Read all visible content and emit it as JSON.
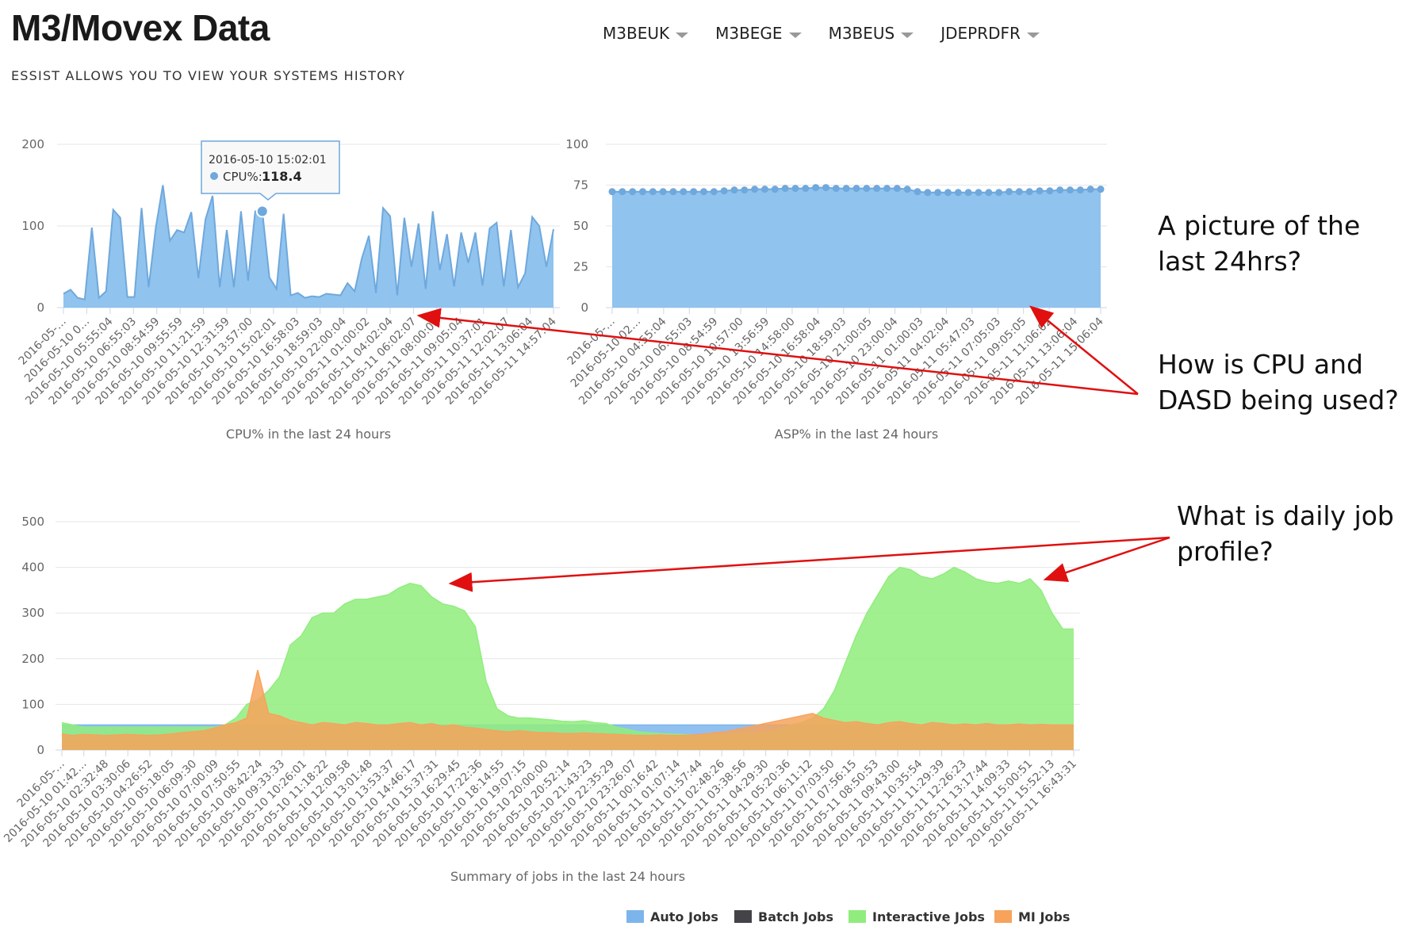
{
  "header": {
    "title": "M3/Movex Data",
    "subtitle": "ESSIST ALLOWS YOU TO VIEW YOUR SYSTEMS HISTORY",
    "nav": [
      "M3BEUK",
      "M3BEGE",
      "M3BEUS",
      "JDEPRDFR"
    ]
  },
  "callouts": {
    "c1": [
      "A picture of the",
      "last 24hrs?"
    ],
    "c2": [
      "How is CPU and",
      "DASD being used?"
    ],
    "c3": [
      "What is daily job",
      "profile?"
    ]
  },
  "colors": {
    "cpu_fill": "#90c3ee",
    "cpu_line": "#6fa8dc",
    "auto": "#7cb5ec",
    "batch": "#434348",
    "interactive": "#90ed7d",
    "mi": "#f7a35c",
    "arrow": "#e01010"
  },
  "chart_data": [
    {
      "type": "area",
      "title": "CPU% in the last 24 hours",
      "ylim": [
        0,
        200
      ],
      "yticks": [
        0,
        100,
        200
      ],
      "grid": true,
      "xtick_labels": [
        "2016-05-…",
        "2016-05-10 0…",
        "2016-05-10 05:55:04",
        "2016-05-10 06:55:03",
        "2016-05-10 08:54:59",
        "2016-05-10 09:55:59",
        "2016-05-10 11:21:59",
        "2016-05-10 12:31:59",
        "2016-05-10 13:57:00",
        "2016-05-10 15:02:01",
        "2016-05-10 16:58:03",
        "2016-05-10 18:59:03",
        "2016-05-10 22:00:04",
        "2016-05-11 01:00:02",
        "2016-05-11 04:02:04",
        "2016-05-11 06:02:07",
        "2016-05-11 08:00:03",
        "2016-05-11 09:05:04",
        "2016-05-11 10:37:01",
        "2016-05-11 12:02:07",
        "2016-05-11 13:06:04",
        "2016-05-11 14:57:04"
      ],
      "values": [
        17,
        22,
        12,
        10,
        98,
        12,
        20,
        120,
        110,
        13,
        13,
        122,
        25,
        98,
        150,
        82,
        95,
        92,
        117,
        36,
        108,
        137,
        25,
        95,
        25,
        118,
        33,
        118,
        118,
        37,
        23,
        115,
        15,
        18,
        12,
        14,
        13,
        17,
        16,
        15,
        30,
        20,
        60,
        88,
        18,
        122,
        112,
        15,
        110,
        50,
        103,
        23,
        118,
        46,
        90,
        26,
        92,
        55,
        92,
        27,
        97,
        104,
        26,
        95,
        25,
        42,
        111,
        100,
        50,
        96
      ],
      "tooltip": {
        "label": "2016-05-10 15:02:01",
        "series": "CPU%:",
        "value": "118.4",
        "index": 28
      }
    },
    {
      "type": "area",
      "title": "ASP% in the last 24 hours",
      "ylim": [
        0,
        100
      ],
      "yticks": [
        0,
        25,
        50,
        75,
        100
      ],
      "grid": true,
      "xtick_labels": [
        "2016-05-…",
        "2016-05-10 02…",
        "2016-05-10 04:55:04",
        "2016-05-10 06:55:03",
        "2016-05-10 08:54:59",
        "2016-05-10 10:57:00",
        "2016-05-10 13:56:59",
        "2016-05-10 14:58:00",
        "2016-05-10 16:58:04",
        "2016-05-10 18:59:03",
        "2016-05-10 21:00:05",
        "2016-05-10 23:00:04",
        "2016-05-11 01:00:03",
        "2016-05-11 04:02:04",
        "2016-05-11 05:47:03",
        "2016-05-11 07:05:03",
        "2016-05-11 09:05:05",
        "2016-05-11 11:06:02",
        "2016-05-11 13:06:04",
        "2016-05-11 15:06:04"
      ],
      "values": [
        71,
        71,
        71,
        71,
        71,
        71,
        71,
        71,
        71,
        71,
        71,
        71.5,
        72,
        72,
        72.5,
        72.5,
        72.5,
        73,
        73,
        73,
        73.5,
        73.5,
        73,
        73,
        73,
        73,
        73,
        73,
        73,
        72.5,
        71,
        70.5,
        70.5,
        70.5,
        70.5,
        70.5,
        70.5,
        70.5,
        70.5,
        71,
        71,
        71,
        71.5,
        71.5,
        72,
        72,
        72,
        72.5,
        72.5
      ]
    },
    {
      "type": "area",
      "title": "Summary of jobs in the last 24 hours",
      "ylim": [
        0,
        500
      ],
      "yticks": [
        0,
        100,
        200,
        300,
        400,
        500
      ],
      "grid": true,
      "legend": "bottom-right",
      "xtick_labels": [
        "2016-05-…",
        "2016-05-10 01:42…",
        "2016-05-10 02:32:48",
        "2016-05-10 03:30:06",
        "2016-05-10 04:26:52",
        "2016-05-10 05:18:05",
        "2016-05-10 06:09:30",
        "2016-05-10 07:00:09",
        "2016-05-10 07:50:55",
        "2016-05-10 08:42:24",
        "2016-05-10 09:33:33",
        "2016-05-10 10:26:01",
        "2016-05-10 11:18:22",
        "2016-05-10 12:09:58",
        "2016-05-10 13:01:48",
        "2016-05-10 13:53:37",
        "2016-05-10 14:46:17",
        "2016-05-10 15:37:31",
        "2016-05-10 16:29:45",
        "2016-05-10 17:22:36",
        "2016-05-10 18:14:55",
        "2016-05-10 19:07:15",
        "2016-05-10 20:00:00",
        "2016-05-10 20:52:14",
        "2016-05-10 21:43:23",
        "2016-05-10 22:35:29",
        "2016-05-10 23:26:07",
        "2016-05-11 00:16:42",
        "2016-05-11 01:07:14",
        "2016-05-11 01:57:44",
        "2016-05-11 02:48:26",
        "2016-05-11 03:38:56",
        "2016-05-11 04:29:30",
        "2016-05-11 05:20:36",
        "2016-05-11 06:11:12",
        "2016-05-11 07:03:50",
        "2016-05-11 07:56:15",
        "2016-05-11 08:50:53",
        "2016-05-11 09:43:00",
        "2016-05-11 10:35:54",
        "2016-05-11 11:29:39",
        "2016-05-11 12:26:23",
        "2016-05-11 13:17:44",
        "2016-05-11 14:09:33",
        "2016-05-11 15:00:51",
        "2016-05-11 15:52:13",
        "2016-05-11 16:43:31"
      ],
      "series": [
        {
          "name": "Auto Jobs",
          "values": [
            55,
            55,
            55,
            55,
            55,
            55,
            55,
            55,
            55,
            55,
            55,
            55,
            55,
            55,
            55,
            55,
            55,
            55,
            55,
            55,
            55,
            55,
            55,
            55,
            55,
            55,
            55,
            55,
            55,
            55,
            55,
            55,
            55,
            55,
            55,
            55,
            55,
            55,
            55,
            55,
            55,
            55,
            55,
            55,
            55,
            55,
            55,
            55,
            55,
            55,
            55,
            55,
            55,
            55,
            55,
            55,
            55,
            55,
            55,
            55,
            55,
            55,
            55,
            55,
            55,
            55,
            55,
            55,
            55,
            55,
            55,
            55,
            55,
            55,
            55,
            55,
            55,
            55,
            55,
            55,
            55,
            55,
            55,
            55,
            55,
            55,
            55,
            55,
            55,
            55,
            55,
            55,
            55,
            55
          ]
        },
        {
          "name": "Batch Jobs",
          "values": []
        },
        {
          "name": "Interactive Jobs",
          "values": [
            60,
            55,
            50,
            50,
            50,
            50,
            50,
            50,
            50,
            50,
            50,
            50,
            50,
            50,
            50,
            55,
            70,
            100,
            110,
            130,
            160,
            230,
            250,
            290,
            300,
            300,
            320,
            330,
            330,
            335,
            340,
            355,
            365,
            360,
            335,
            320,
            315,
            305,
            270,
            150,
            90,
            75,
            70,
            70,
            68,
            66,
            63,
            62,
            64,
            60,
            58,
            50,
            45,
            40,
            38,
            36,
            35,
            34,
            33,
            33,
            33,
            34,
            35,
            36,
            37,
            40,
            45,
            55,
            60,
            70,
            90,
            130,
            190,
            250,
            300,
            340,
            380,
            400,
            395,
            380,
            375,
            385,
            400,
            390,
            375,
            368,
            365,
            370,
            365,
            375,
            350,
            300,
            265,
            265
          ]
        },
        {
          "name": "MI Jobs",
          "values": [
            35,
            32,
            34,
            33,
            32,
            33,
            34,
            33,
            32,
            33,
            35,
            38,
            40,
            42,
            48,
            55,
            60,
            70,
            175,
            80,
            75,
            65,
            60,
            55,
            60,
            58,
            55,
            60,
            58,
            55,
            55,
            58,
            60,
            55,
            58,
            52,
            55,
            50,
            48,
            45,
            42,
            40,
            42,
            40,
            38,
            38,
            36,
            36,
            37,
            36,
            35,
            34,
            33,
            32,
            32,
            33,
            32,
            32,
            33,
            35,
            38,
            40,
            45,
            50,
            55,
            60,
            65,
            70,
            75,
            80,
            70,
            65,
            60,
            62,
            58,
            55,
            60,
            62,
            58,
            55,
            60,
            58,
            55,
            57,
            55,
            58,
            55,
            55,
            57,
            55,
            56,
            55,
            55,
            55
          ]
        }
      ]
    }
  ]
}
